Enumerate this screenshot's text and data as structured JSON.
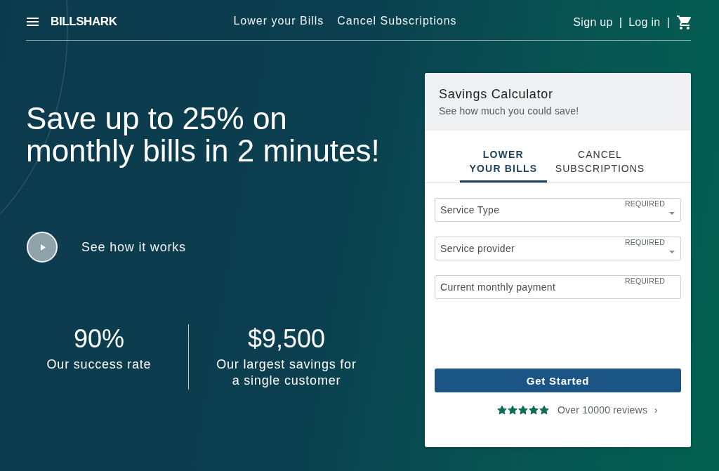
{
  "nav": {
    "brand": "BILLSHARK",
    "links": [
      "Lower your Bills",
      "Cancel Subscriptions"
    ],
    "account": [
      {
        "kind": "link",
        "text": "Sign up"
      },
      {
        "kind": "separator",
        "text": "|"
      },
      {
        "kind": "link",
        "text": "Log in"
      },
      {
        "kind": "separator",
        "text": "|"
      },
      {
        "kind": "cart"
      }
    ]
  },
  "hero": {
    "heading": "Save up to 25% on monthly bills in 2 minutes!",
    "video_link": "See how it works",
    "stats": [
      {
        "value": "90%",
        "caption": "Our success rate"
      },
      {
        "value": "$9,500",
        "caption": "Our largest savings for a single customer"
      }
    ]
  },
  "calculator": {
    "title": "Savings Calculator",
    "subtitle": "See how much you could save!",
    "tabs": [
      {
        "label": "LOWER YOUR BILLS",
        "selected": true
      },
      {
        "label": "CANCEL SUBSCRIPTIONS",
        "selected": false
      }
    ],
    "fields": [
      {
        "kind": "select",
        "label": "Service Type",
        "tag": "REQUIRED"
      },
      {
        "kind": "select",
        "label": "Service provider",
        "tag": "REQUIRED"
      },
      {
        "kind": "text",
        "label": "Current monthly payment",
        "tag": "REQUIRED"
      }
    ],
    "button": "Get Started",
    "rating": {
      "stars": 5,
      "text": "Over 10000 reviews",
      "chevron": "›"
    }
  }
}
